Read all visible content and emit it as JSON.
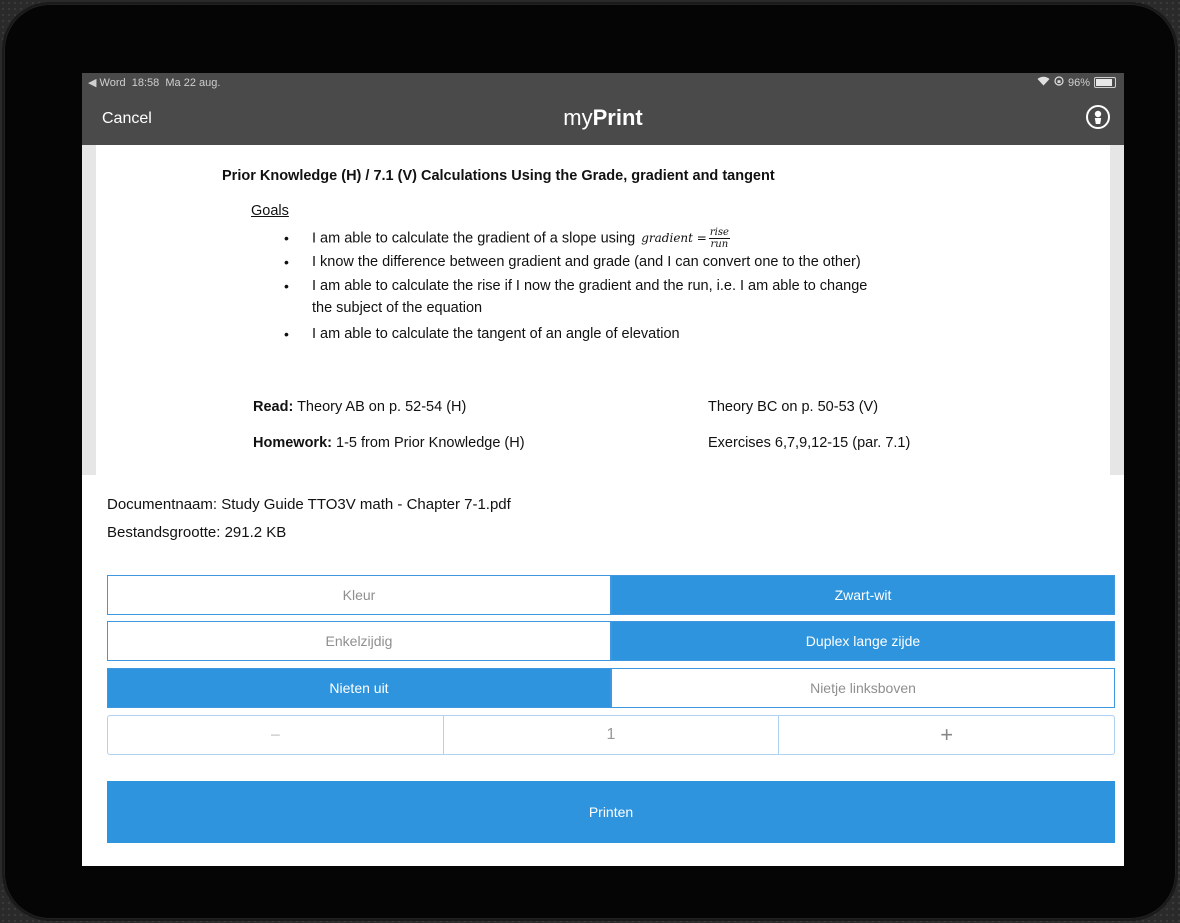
{
  "status_bar": {
    "back_app": "◀ Word",
    "time": "18:58",
    "date": "Ma 22 aug.",
    "battery": "96%"
  },
  "nav": {
    "cancel": "Cancel",
    "title_prefix": "my",
    "title_bold": "Print"
  },
  "document_preview": {
    "title": "Prior Knowledge (H) / 7.1 (V) Calculations Using the Grade, gradient and tangent",
    "goals_heading": "Goals",
    "goals": [
      "I am able to calculate the gradient of a slope using",
      "I know the difference between gradient and grade (and I can convert one to the other)",
      "I am able to calculate the rise if I now the gradient and the run, i.e.  I am able to change",
      "the subject of the equation",
      "I am able to calculate the tangent of an angle of elevation"
    ],
    "formula": {
      "lhs": "gradient =",
      "numerator": "rise",
      "denominator": "run"
    },
    "read_label": "Read:",
    "read_h": "Theory AB on p. 52-54 (H)",
    "read_v": "Theory BC on p. 50-53 (V)",
    "homework_label": "Homework:",
    "homework_h": "1-5 from Prior Knowledge (H)",
    "homework_v": "Exercises 6,7,9,12-15 (par. 7.1)"
  },
  "file_info": {
    "name_line": "Documentnaam: Study Guide TTO3V math - Chapter 7-1.pdf",
    "size_line": "Bestandsgrootte: 291.2 KB"
  },
  "options": {
    "color": [
      "Kleur",
      "Zwart-wit"
    ],
    "sides": [
      "Enkelzijdig",
      "Duplex lange zijde"
    ],
    "staple": [
      "Nieten uit",
      "Nietje linksboven"
    ]
  },
  "copies": {
    "minus": "−",
    "value": "1",
    "plus": "+"
  },
  "print_button": "Printen",
  "colors": {
    "accent": "#2e94dd",
    "navbar": "#4a4a4a"
  }
}
